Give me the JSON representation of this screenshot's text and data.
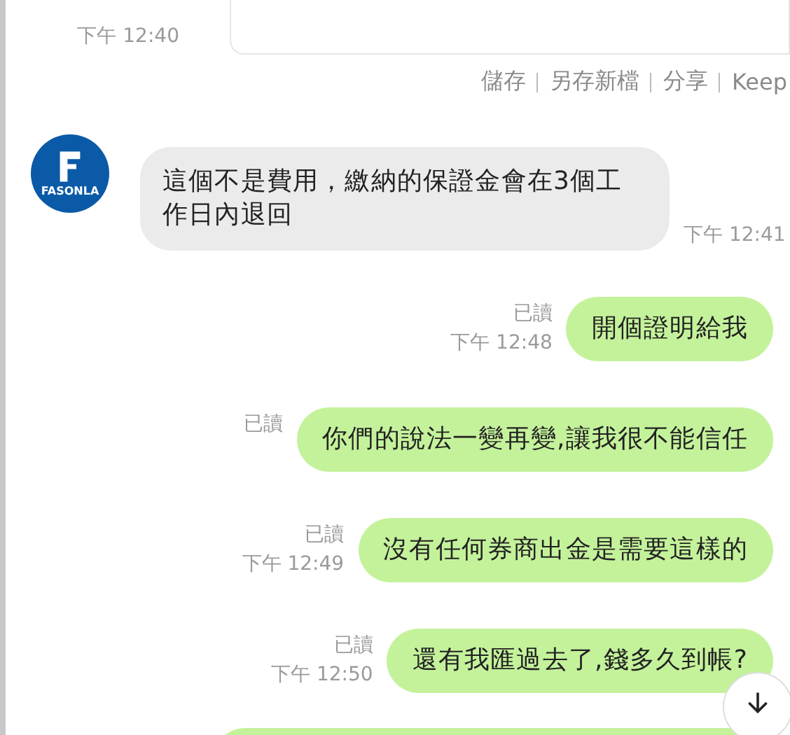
{
  "top_message": {
    "time": "下午 12:40"
  },
  "actions": [
    "儲存",
    "另存新檔",
    "分享",
    "Keep"
  ],
  "avatar": {
    "label": "FASONLA"
  },
  "messages": [
    {
      "kind": "incoming",
      "text": "這個不是費用，繳納的保證金會在3個工作日內退回",
      "time": "下午 12:41"
    },
    {
      "kind": "outgoing",
      "read": "已讀",
      "time": "下午 12:48",
      "text": "開個證明給我"
    },
    {
      "kind": "outgoing",
      "read": "已讀",
      "text": "你們的說法一變再變,讓我很不能信任"
    },
    {
      "kind": "outgoing",
      "read": "已讀",
      "time": "下午 12:49",
      "text": "沒有任何券商出金是需要這樣的"
    },
    {
      "kind": "outgoing",
      "read": "已讀",
      "time": "下午 12:50",
      "text": "還有我匯過去了,錢多久到帳?"
    },
    {
      "kind": "outgoing"
    }
  ]
}
